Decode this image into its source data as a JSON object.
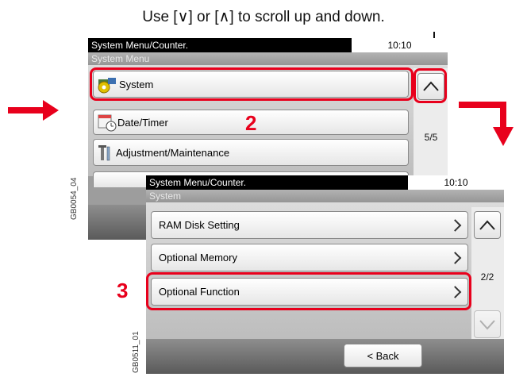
{
  "caption": "Use [∨] or [∧] to scroll up and down.",
  "screen1": {
    "header_title": "System Menu/Counter.",
    "time": "10:10",
    "subheader": "System Menu",
    "items": [
      {
        "label": "System",
        "icon": "system-gear-icon"
      },
      {
        "label": "Date/Timer",
        "icon": "calendar-clock-icon"
      },
      {
        "label": "Adjustment/Maintenance",
        "icon": "tools-icon"
      }
    ],
    "page": "5/5",
    "side_code": "GB0054_04"
  },
  "screen2": {
    "header_title": "System Menu/Counter.",
    "time": "10:10",
    "subheader": "System",
    "items": [
      {
        "label": "RAM Disk Setting"
      },
      {
        "label": "Optional Memory"
      },
      {
        "label": "Optional Function"
      }
    ],
    "page": "2/2",
    "back_label": "< Back",
    "side_code": "GB0511_01"
  },
  "steps": {
    "step2": "2",
    "step3": "3"
  },
  "colors": {
    "highlight": "#e8001c",
    "arrow": "#e8001c"
  }
}
